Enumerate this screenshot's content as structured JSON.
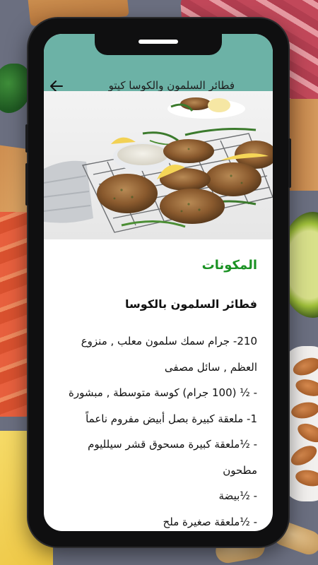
{
  "app_bar": {
    "title": "فطائر السلمون والكوسا كيتو",
    "back_icon": "arrow-left-icon",
    "background_color": "#6cb2a6"
  },
  "hero_image": {
    "description_icon": "salmon-zucchini-patties-photo"
  },
  "content": {
    "section_heading": "المكونات",
    "section_heading_color": "#1b9224",
    "recipe_title": "فطائر السلمون بالكوسا",
    "ingredients": [
      "210- جرام سمك سلمون معلب , منزوع العظم , سائل مصفى",
      "- ½ (100 جرام) كوسة متوسطة , مبشورة",
      "1- ملعقة كبيرة بصل أبيض مفروم ناعماً",
      "- ½ملعقة كبيرة مسحوق قشر سيلليوم مطحون",
      "- ½بيضة",
      "- ½ملعقة صغيرة ملح"
    ]
  }
}
